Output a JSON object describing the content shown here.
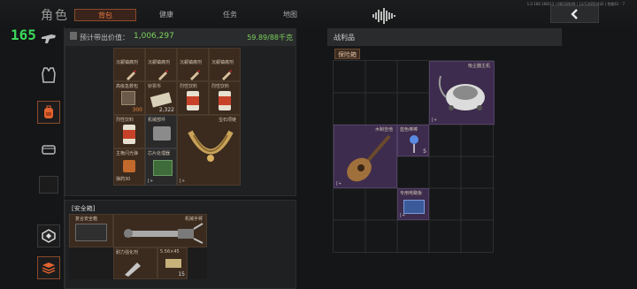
{
  "header": {
    "title": "角色",
    "tabs": [
      {
        "label": "背包",
        "active": true
      },
      {
        "label": "健康",
        "active": false
      },
      {
        "label": "任务",
        "active": false
      },
      {
        "label": "地图",
        "active": false
      }
    ],
    "fps": "165",
    "sysinfo": "1.0.166.166/13 | 06018049 | 12/13/850432 | 性能61 - 7"
  },
  "backpack": {
    "value_label": "预计带出价值：",
    "value": "1,006,297",
    "weight": "59.89/88千克",
    "items": [
      {
        "name": "沉銀镇痛剂",
        "count": ""
      },
      {
        "name": "沉銀镇痛剂",
        "count": ""
      },
      {
        "name": "沉銀镇痛剂",
        "count": ""
      },
      {
        "name": "沉銀镇痛剂",
        "count": ""
      },
      {
        "name": "高级急救包",
        "count": "300"
      },
      {
        "name": "钞票币",
        "count": "2,322"
      },
      {
        "name": "烈性饮料",
        "count": ""
      },
      {
        "name": "烈性饮料",
        "count": ""
      },
      {
        "name": "烈性饮料",
        "count": ""
      },
      {
        "name": "机械部件",
        "count": ""
      },
      {
        "name": "宝石项链",
        "count": ""
      },
      {
        "name": "芯片处理器",
        "count": ""
      },
      {
        "name": "主桅闪光弹",
        "count": "弹药30"
      }
    ]
  },
  "safebox": {
    "label": "安全箱",
    "items": [
      {
        "name": "复合安全箱",
        "count": ""
      },
      {
        "name": "机械手臂",
        "count": ""
      },
      {
        "name": "耐力强化剂",
        "count": ""
      },
      {
        "name": "5.56×45",
        "count": "15"
      }
    ]
  },
  "loot": {
    "title": "战利品",
    "container": "保险箱",
    "items": [
      {
        "name": "吸尘器主机",
        "count": ""
      },
      {
        "name": "木制吉他",
        "count": ""
      },
      {
        "name": "蓝色棒棒",
        "count": "5"
      },
      {
        "name": "专用电路板",
        "count": ""
      }
    ]
  },
  "colors": {
    "accent": "#e77a43",
    "green": "#3bd95a",
    "purple": "#3d2c4d"
  }
}
